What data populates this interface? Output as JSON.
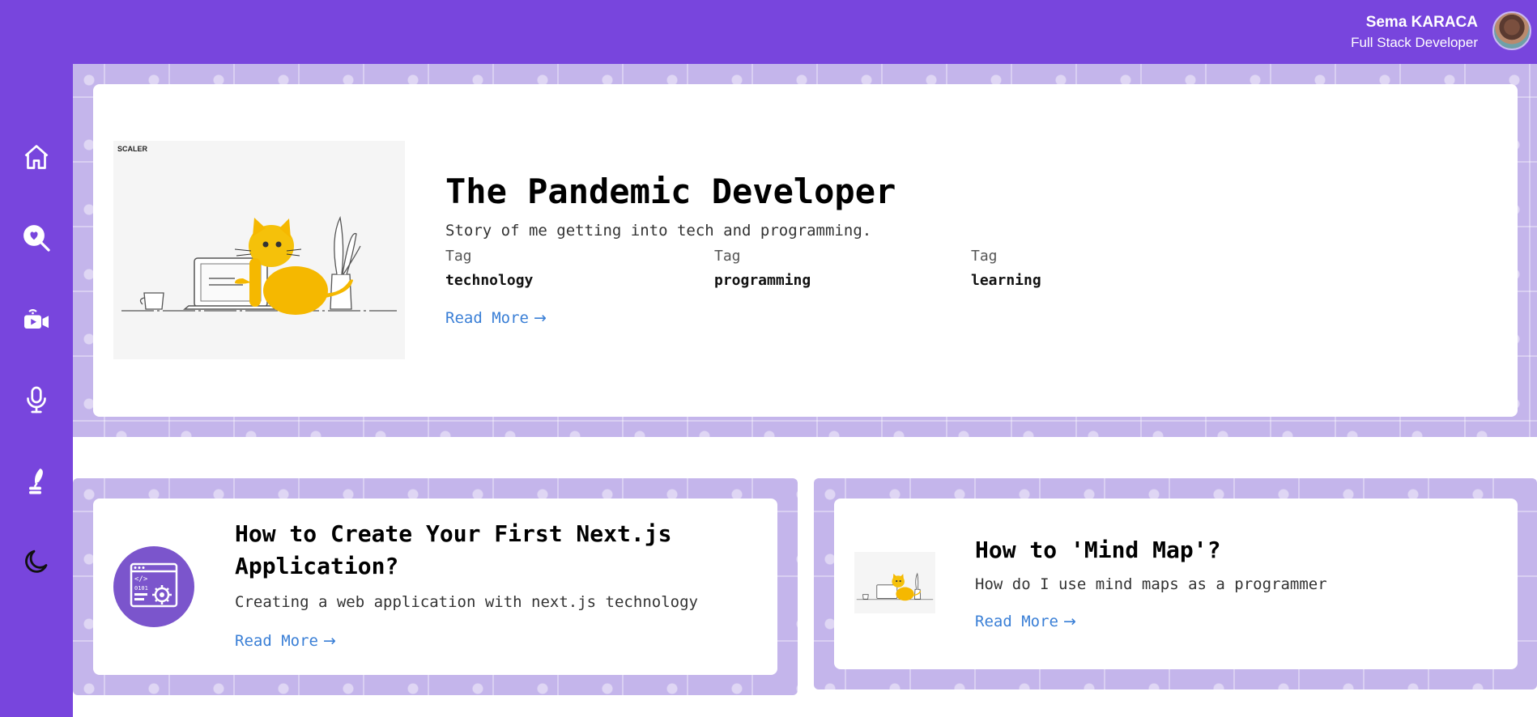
{
  "user": {
    "name": "Sema KARACA",
    "role": "Full Stack Developer"
  },
  "sidebar": {
    "items": [
      {
        "icon": "home-icon",
        "label": "Home"
      },
      {
        "icon": "search-heart-icon",
        "label": "Search"
      },
      {
        "icon": "video-camera-icon",
        "label": "Videos"
      },
      {
        "icon": "microphone-icon",
        "label": "Podcasts"
      },
      {
        "icon": "quill-pen-icon",
        "label": "Writing"
      },
      {
        "icon": "moon-icon",
        "label": "Dark mode"
      }
    ]
  },
  "featured": {
    "thumb_logo": "SCALER",
    "title": "The Pandemic Developer",
    "description": "Story of me getting into tech and programming.",
    "tags": [
      {
        "label": "Tag",
        "value": "technology"
      },
      {
        "label": "Tag",
        "value": "programming"
      },
      {
        "label": "Tag",
        "value": "learning"
      }
    ],
    "read_more": "Read More",
    "arrow": "→"
  },
  "posts": [
    {
      "title": "How to Create Your First Next.js Application?",
      "description": "Creating a web application with next.js technology",
      "read_more": "Read More",
      "arrow": "→"
    },
    {
      "title": "How to 'Mind Map'?",
      "description": "How do I use mind maps as a programmer",
      "read_more": "Read More",
      "arrow": "→"
    }
  ],
  "colors": {
    "brand": "#7845dd",
    "pattern": "#c4b5eb",
    "link": "#3a7fd6",
    "cat": "#f5b800"
  }
}
